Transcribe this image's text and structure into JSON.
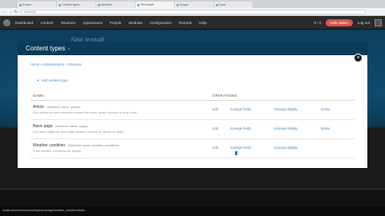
{
  "browser": {
    "tabs": [
      "Drupal",
      "Content types",
      "Modules",
      "Site Install",
      "Drupal",
      "Docs"
    ],
    "url": "localhost"
  },
  "toolbar": {
    "items": [
      "Dashboard",
      "Content",
      "Structure",
      "Appearance",
      "People",
      "Modules",
      "Configuration",
      "Reports",
      "Help"
    ],
    "count": "0 / 0",
    "hello": "Hello admin",
    "logout": "Log out"
  },
  "site": {
    "name": "Site Install"
  },
  "modal": {
    "title": "Content types",
    "help": "?",
    "close": "×",
    "breadcrumb": "Home » Administration » Structure",
    "add_link": "Add content type",
    "col_name": "NAME",
    "col_ops": "OPERATIONS",
    "rows": [
      {
        "name": "Article",
        "machine": "(Machine name: article)",
        "desc": "Use articles for time-sensitive content like news, press releases or blog posts.",
        "ops": [
          "edit",
          "manage fields",
          "manage display",
          "delete"
        ]
      },
      {
        "name": "Basic page",
        "machine": "(Machine name: page)",
        "desc": "Use basic pages for your static content, such as an 'About us' page.",
        "ops": [
          "edit",
          "manage fields",
          "manage display",
          "delete"
        ]
      },
      {
        "name": "Weather condition",
        "machine": "(Machine name: weather_condition)",
        "desc": "Enter weather conditions for display",
        "ops": [
          "edit",
          "manage fields",
          "manage display"
        ]
      }
    ]
  },
  "status": "localhost/admin/structure/types/manage/weather_condition/fields"
}
